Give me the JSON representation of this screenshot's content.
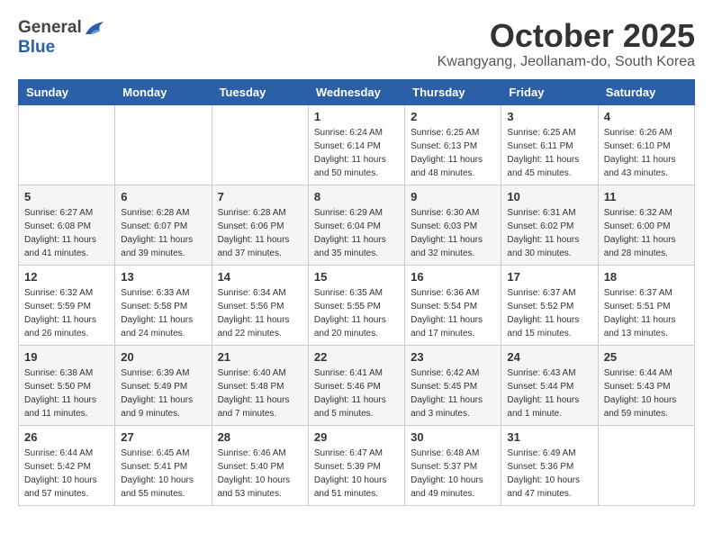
{
  "header": {
    "logo_general": "General",
    "logo_blue": "Blue",
    "month": "October 2025",
    "location": "Kwangyang, Jeollanam-do, South Korea"
  },
  "days_of_week": [
    "Sunday",
    "Monday",
    "Tuesday",
    "Wednesday",
    "Thursday",
    "Friday",
    "Saturday"
  ],
  "weeks": [
    [
      {
        "day": "",
        "info": ""
      },
      {
        "day": "",
        "info": ""
      },
      {
        "day": "",
        "info": ""
      },
      {
        "day": "1",
        "info": "Sunrise: 6:24 AM\nSunset: 6:14 PM\nDaylight: 11 hours\nand 50 minutes."
      },
      {
        "day": "2",
        "info": "Sunrise: 6:25 AM\nSunset: 6:13 PM\nDaylight: 11 hours\nand 48 minutes."
      },
      {
        "day": "3",
        "info": "Sunrise: 6:25 AM\nSunset: 6:11 PM\nDaylight: 11 hours\nand 45 minutes."
      },
      {
        "day": "4",
        "info": "Sunrise: 6:26 AM\nSunset: 6:10 PM\nDaylight: 11 hours\nand 43 minutes."
      }
    ],
    [
      {
        "day": "5",
        "info": "Sunrise: 6:27 AM\nSunset: 6:08 PM\nDaylight: 11 hours\nand 41 minutes."
      },
      {
        "day": "6",
        "info": "Sunrise: 6:28 AM\nSunset: 6:07 PM\nDaylight: 11 hours\nand 39 minutes."
      },
      {
        "day": "7",
        "info": "Sunrise: 6:28 AM\nSunset: 6:06 PM\nDaylight: 11 hours\nand 37 minutes."
      },
      {
        "day": "8",
        "info": "Sunrise: 6:29 AM\nSunset: 6:04 PM\nDaylight: 11 hours\nand 35 minutes."
      },
      {
        "day": "9",
        "info": "Sunrise: 6:30 AM\nSunset: 6:03 PM\nDaylight: 11 hours\nand 32 minutes."
      },
      {
        "day": "10",
        "info": "Sunrise: 6:31 AM\nSunset: 6:02 PM\nDaylight: 11 hours\nand 30 minutes."
      },
      {
        "day": "11",
        "info": "Sunrise: 6:32 AM\nSunset: 6:00 PM\nDaylight: 11 hours\nand 28 minutes."
      }
    ],
    [
      {
        "day": "12",
        "info": "Sunrise: 6:32 AM\nSunset: 5:59 PM\nDaylight: 11 hours\nand 26 minutes."
      },
      {
        "day": "13",
        "info": "Sunrise: 6:33 AM\nSunset: 5:58 PM\nDaylight: 11 hours\nand 24 minutes."
      },
      {
        "day": "14",
        "info": "Sunrise: 6:34 AM\nSunset: 5:56 PM\nDaylight: 11 hours\nand 22 minutes."
      },
      {
        "day": "15",
        "info": "Sunrise: 6:35 AM\nSunset: 5:55 PM\nDaylight: 11 hours\nand 20 minutes."
      },
      {
        "day": "16",
        "info": "Sunrise: 6:36 AM\nSunset: 5:54 PM\nDaylight: 11 hours\nand 17 minutes."
      },
      {
        "day": "17",
        "info": "Sunrise: 6:37 AM\nSunset: 5:52 PM\nDaylight: 11 hours\nand 15 minutes."
      },
      {
        "day": "18",
        "info": "Sunrise: 6:37 AM\nSunset: 5:51 PM\nDaylight: 11 hours\nand 13 minutes."
      }
    ],
    [
      {
        "day": "19",
        "info": "Sunrise: 6:38 AM\nSunset: 5:50 PM\nDaylight: 11 hours\nand 11 minutes."
      },
      {
        "day": "20",
        "info": "Sunrise: 6:39 AM\nSunset: 5:49 PM\nDaylight: 11 hours\nand 9 minutes."
      },
      {
        "day": "21",
        "info": "Sunrise: 6:40 AM\nSunset: 5:48 PM\nDaylight: 11 hours\nand 7 minutes."
      },
      {
        "day": "22",
        "info": "Sunrise: 6:41 AM\nSunset: 5:46 PM\nDaylight: 11 hours\nand 5 minutes."
      },
      {
        "day": "23",
        "info": "Sunrise: 6:42 AM\nSunset: 5:45 PM\nDaylight: 11 hours\nand 3 minutes."
      },
      {
        "day": "24",
        "info": "Sunrise: 6:43 AM\nSunset: 5:44 PM\nDaylight: 11 hours\nand 1 minute."
      },
      {
        "day": "25",
        "info": "Sunrise: 6:44 AM\nSunset: 5:43 PM\nDaylight: 10 hours\nand 59 minutes."
      }
    ],
    [
      {
        "day": "26",
        "info": "Sunrise: 6:44 AM\nSunset: 5:42 PM\nDaylight: 10 hours\nand 57 minutes."
      },
      {
        "day": "27",
        "info": "Sunrise: 6:45 AM\nSunset: 5:41 PM\nDaylight: 10 hours\nand 55 minutes."
      },
      {
        "day": "28",
        "info": "Sunrise: 6:46 AM\nSunset: 5:40 PM\nDaylight: 10 hours\nand 53 minutes."
      },
      {
        "day": "29",
        "info": "Sunrise: 6:47 AM\nSunset: 5:39 PM\nDaylight: 10 hours\nand 51 minutes."
      },
      {
        "day": "30",
        "info": "Sunrise: 6:48 AM\nSunset: 5:37 PM\nDaylight: 10 hours\nand 49 minutes."
      },
      {
        "day": "31",
        "info": "Sunrise: 6:49 AM\nSunset: 5:36 PM\nDaylight: 10 hours\nand 47 minutes."
      },
      {
        "day": "",
        "info": ""
      }
    ]
  ]
}
